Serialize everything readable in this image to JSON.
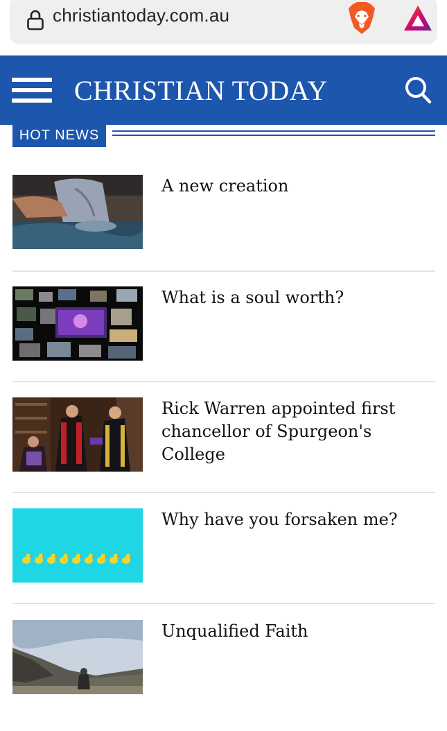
{
  "browser": {
    "url": "christiantoday.com.au",
    "icons": [
      "lock-icon",
      "brave-lion-icon",
      "brave-rewards-icon"
    ]
  },
  "header": {
    "brand": "CHRISTIAN TODAY",
    "icons": [
      "menu-icon",
      "search-icon"
    ],
    "color": "#1d56ad"
  },
  "section": {
    "label": "HOT NEWS"
  },
  "articles": [
    {
      "title": "A new creation"
    },
    {
      "title": "What is a soul worth?"
    },
    {
      "title": "Rick Warren appointed first chancellor of Spurgeon's College"
    },
    {
      "title": "Why have you forsaken me?"
    },
    {
      "title": "Unqualified Faith"
    }
  ]
}
